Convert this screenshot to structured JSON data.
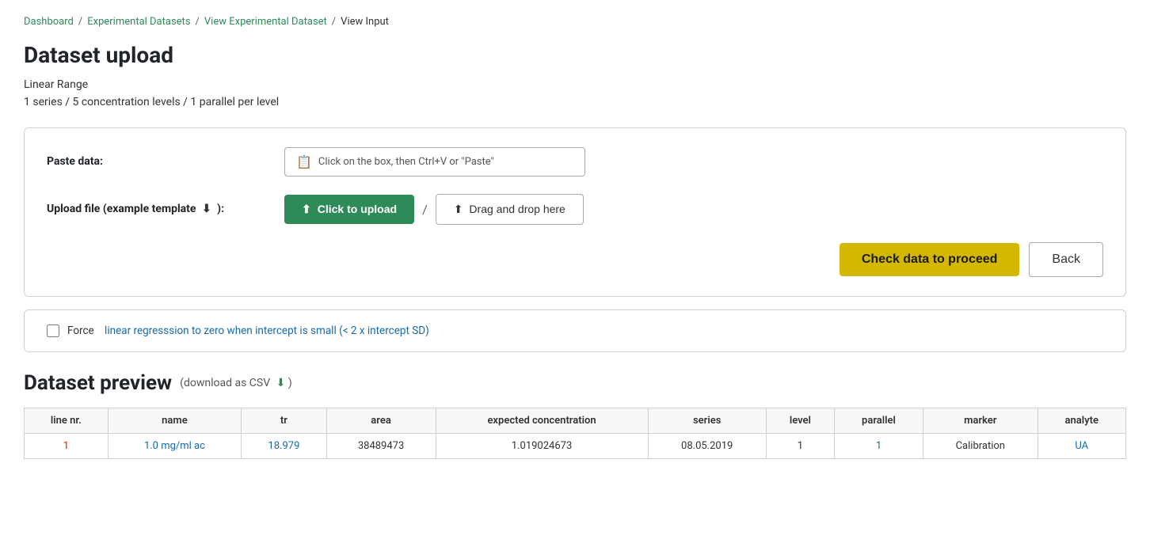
{
  "breadcrumb": {
    "items": [
      {
        "label": "Dashboard",
        "href": "#"
      },
      {
        "label": "Experimental Datasets",
        "href": "#"
      },
      {
        "label": "View Experimental Dataset",
        "href": "#"
      },
      {
        "label": "View Input",
        "current": true
      }
    ]
  },
  "page": {
    "title": "Dataset upload",
    "dataset_info_line1": "Linear Range",
    "dataset_info_line2": "1 series / 5 concentration levels / 1 parallel per level"
  },
  "upload_card": {
    "paste_label": "Paste data:",
    "paste_placeholder": "Click on the box, then Ctrl+V or \"Paste\"",
    "upload_label": "Upload file (example template",
    "upload_label_suffix": "):",
    "upload_button": "Click to upload",
    "drag_button": "Drag and drop here",
    "check_button": "Check data to proceed",
    "back_button": "Back"
  },
  "regression_card": {
    "label_prefix": "Force",
    "label_highlight": "linear regresssion to zero when intercept is small (< 2 x intercept SD)",
    "checked": false
  },
  "preview": {
    "title": "Dataset preview",
    "csv_text": "(download as CSV",
    "columns": [
      "line nr.",
      "name",
      "tr",
      "area",
      "expected concentration",
      "series",
      "level",
      "parallel",
      "marker",
      "analyte"
    ],
    "rows": [
      {
        "line_nr": "1",
        "name": "1.0 mg/ml ac",
        "tr": "18.979",
        "area": "38489473",
        "expected_concentration": "1.019024673",
        "series": "08.05.2019",
        "level": "1",
        "parallel": "1",
        "marker": "Calibration",
        "analyte": "UA"
      }
    ]
  }
}
